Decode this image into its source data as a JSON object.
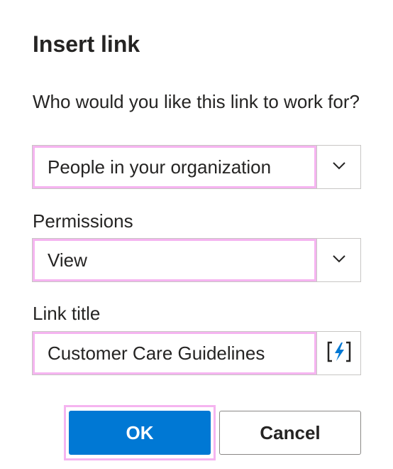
{
  "dialog": {
    "title": "Insert link"
  },
  "audience": {
    "label": "Who would you like this link to work for?",
    "selected": "People in your organization",
    "icon": "chevron-down-icon"
  },
  "permissions": {
    "label": "Permissions",
    "selected": "View",
    "icon": "chevron-down-icon"
  },
  "link_title": {
    "label": "Link title",
    "value": "Customer Care Guidelines",
    "icon": "dynamic-content-icon",
    "accent_color": "#0078d4"
  },
  "buttons": {
    "ok_label": "OK",
    "cancel_label": "Cancel"
  },
  "colors": {
    "primary": "#0078d4",
    "highlight": "#f5b4f0"
  }
}
